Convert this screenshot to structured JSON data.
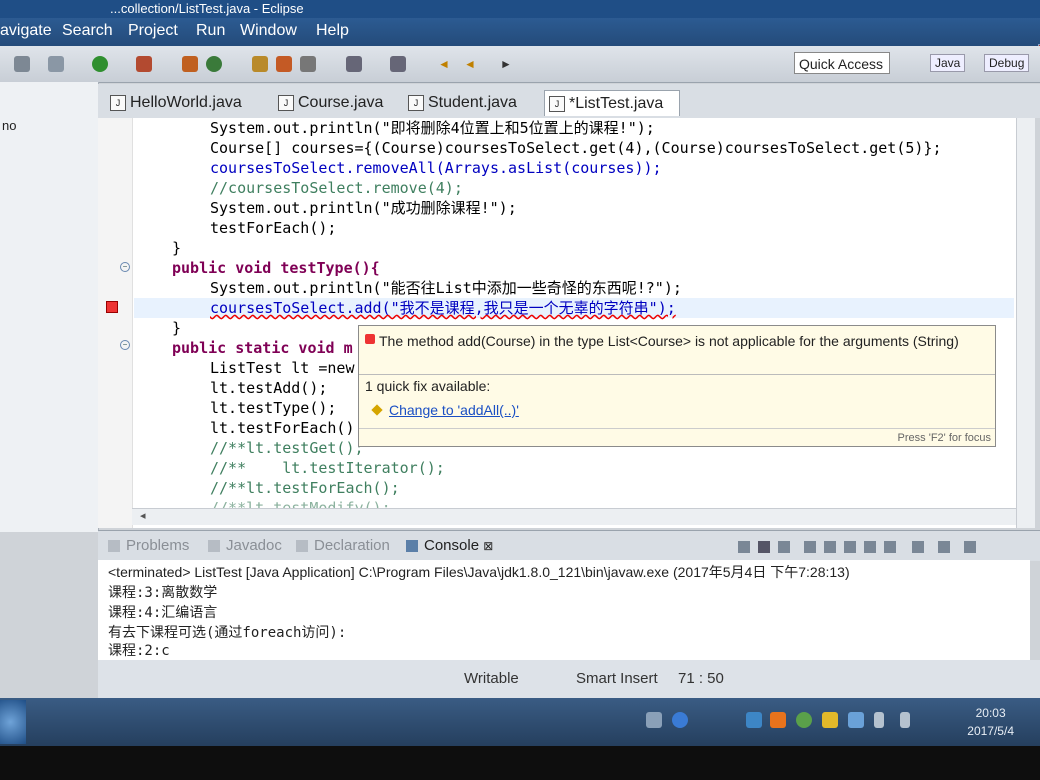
{
  "window": {
    "title": "...collection/ListTest.java - Eclipse"
  },
  "menu": [
    "avigate",
    "Search",
    "Project",
    "Run",
    "Window",
    "Help"
  ],
  "toolbar": {
    "quick_access": "Quick Access",
    "perspective_java": "Java",
    "perspective_debug": "Debug"
  },
  "left_panel": {
    "label": "no"
  },
  "editor_tabs": [
    {
      "label": "HelloWorld.java"
    },
    {
      "label": "Course.java"
    },
    {
      "label": "Student.java"
    },
    {
      "label": "*ListTest.java",
      "close": "⊠"
    }
  ],
  "code_lines": [
    "System.out.println(\"即将删除4位置上和5位置上的课程!\");",
    "Course[] courses={(Course)coursesToSelect.get(4),(Course)coursesToSelect.get(5)};",
    "coursesToSelect.removeAll(Arrays.asList(courses));",
    "//coursesToSelect.remove(4);",
    "System.out.println(\"成功删除课程!\");",
    "testForEach();",
    "}",
    "public void testType(){",
    "System.out.println(\"能否往List中添加一些奇怪的东西呢!?\");",
    "coursesToSelect.add(\"我不是课程,我只是一个无辜的字符串\");",
    "}",
    "public static void m",
    "ListTest lt =new",
    "lt.testAdd();",
    "lt.testType();",
    "lt.testForEach()",
    "//**lt.testGet();",
    "//**    lt.testIterator();",
    "//**lt.testForEach();",
    "//**lt.testModify();"
  ],
  "popup": {
    "message": "The method add(Course) in the type List<Course> is not applicable for the arguments (String)",
    "fix_count": "1 quick fix available:",
    "fix": "Change to 'addAll(..)'",
    "footer": "Press 'F2' for focus"
  },
  "console_tabs": [
    {
      "label": "Problems"
    },
    {
      "label": "Javadoc"
    },
    {
      "label": "Declaration"
    },
    {
      "label": "Console",
      "close": "⊠"
    }
  ],
  "console": {
    "terminated": "<terminated> ListTest [Java Application] C:\\Program Files\\Java\\jdk1.8.0_121\\bin\\javaw.exe (2017年5月4日 下午7:28:13)",
    "lines": [
      "课程:3:离散数学",
      "课程:4:汇编语言",
      "有去下课程可选(通过foreach访问):",
      "课程:2:c"
    ]
  },
  "status": {
    "writable": "Writable",
    "insert": "Smart Insert",
    "position": "71 : 50"
  },
  "taskbar": {
    "time": "20:03",
    "date": "2017/5/4"
  }
}
